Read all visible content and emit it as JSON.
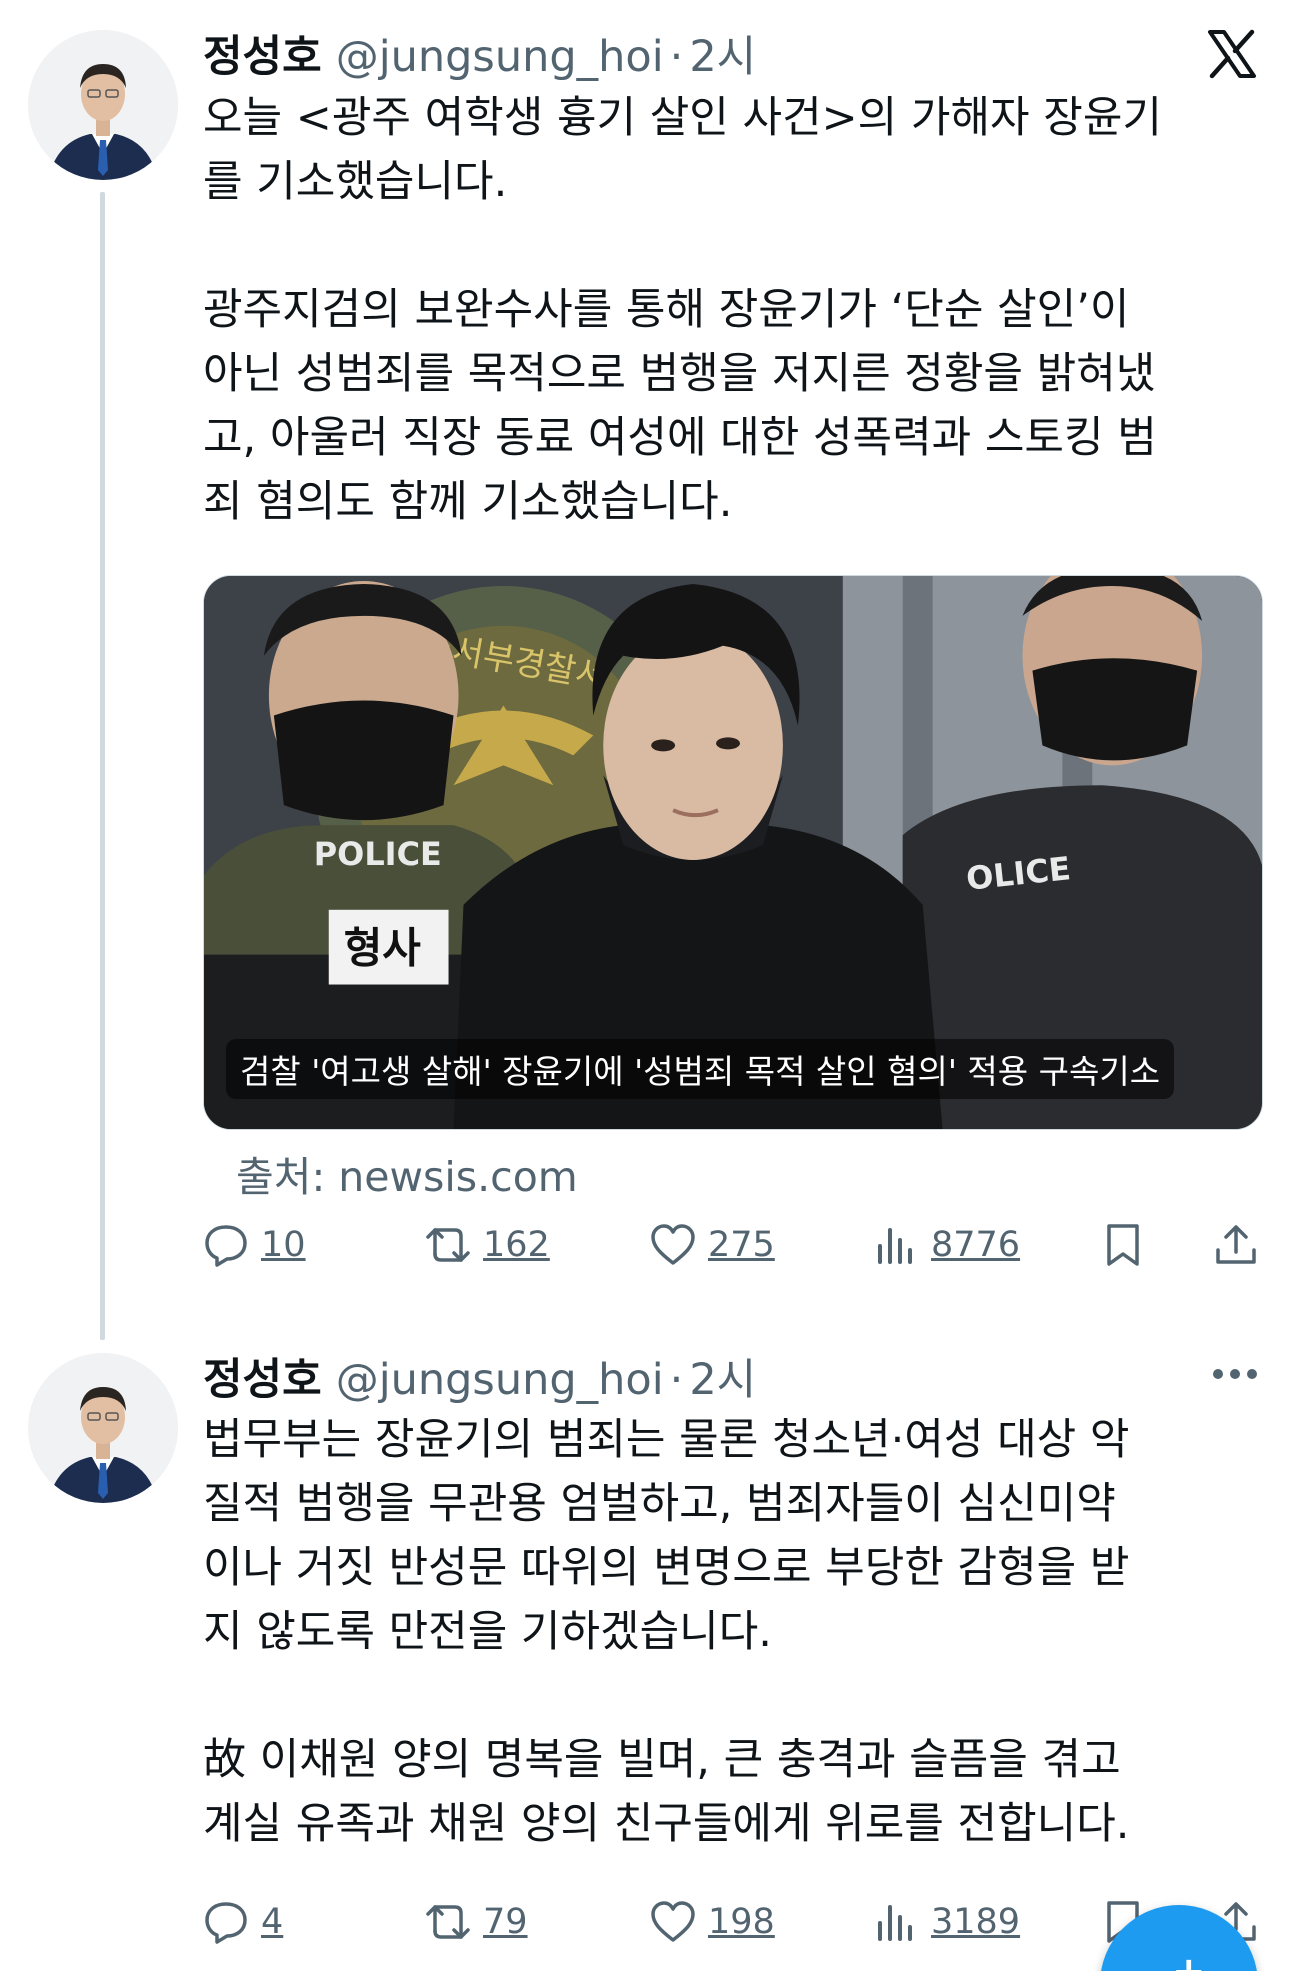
{
  "colors": {
    "text_primary": "#0f1419",
    "text_secondary": "#536471",
    "thread_line": "#cfd9de",
    "accent": "#1d9bf0"
  },
  "tweets": [
    {
      "author_name": "정성호",
      "handle": "@jungsung_hoi",
      "dot": "·",
      "time": "2시",
      "header_icon": "x-logo",
      "text_lines": [
        "오늘 <광주 여학생 흉기 살인 사건>의 가해자 장윤기",
        "를 기소했습니다.",
        "",
        "광주지검의 보완수사를 통해 장윤기가 ‘단순 살인’이",
        "아닌 성범죄를 목적으로 범행을 저지른 정황을 밝혀냈",
        "고, 아울러 직장 동료 여성에 대한 성폭력과 스토킹 범",
        "죄 혐의도 함께 기소했습니다."
      ],
      "media": {
        "caption": "검찰 '여고생 살해' 장윤기에 '성범죄 목적 살인 혐의' 적용 구속기소",
        "vest_text_left": "POLICE",
        "vest_text_right": "OLICE",
        "badge_text": "형사",
        "sign_text": "주서부경찰서"
      },
      "source": "출처: newsis.com",
      "actions": {
        "replies": "10",
        "retweets": "162",
        "likes": "275",
        "views": "8776"
      }
    },
    {
      "author_name": "정성호",
      "handle": "@jungsung_hoi",
      "dot": "·",
      "time": "2시",
      "header_icon": "more-icon",
      "text_lines": [
        "법무부는 장윤기의 범죄는 물론 청소년·여성 대상 악",
        "질적 범행을 무관용 엄벌하고, 범죄자들이 심신미약",
        "이나 거짓 반성문 따위의 변명으로 부당한 감형을 받",
        "지 않도록 만전을 기하겠습니다.",
        "",
        "故 이채원 양의 명복을 빌며, 큰 충격과 슬픔을 겪고",
        "계실 유족과 채원 양의 친구들에게 위로를 전합니다."
      ],
      "actions": {
        "replies": "4",
        "retweets": "79",
        "likes": "198",
        "views": "3189"
      }
    }
  ],
  "fab": {
    "icon": "plus-icon",
    "label": "+"
  }
}
